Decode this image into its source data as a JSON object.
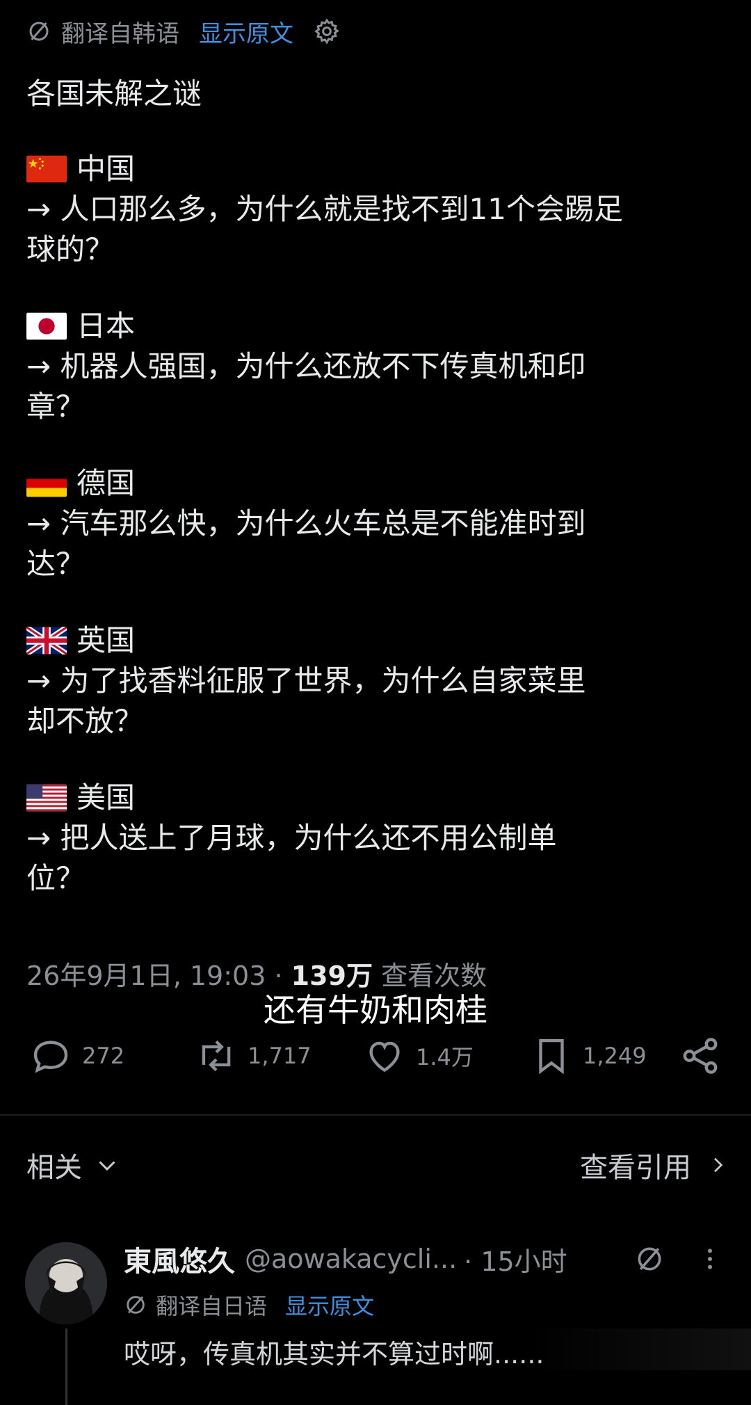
{
  "translate": {
    "label": "翻译自韩语",
    "show_original": "显示原文"
  },
  "post": {
    "title": "各国未解之谜",
    "items": [
      {
        "country": "中国",
        "flag": "china-flag",
        "line1": "→ 人口那么多，为什么就是找不到11个会踢足",
        "line2": "球的？"
      },
      {
        "country": "日本",
        "flag": "japan-flag",
        "line1": "→ 机器人强国，为什么还放不下传真机和印",
        "line2": "章？"
      },
      {
        "country": "德国",
        "flag": "germany-flag",
        "line1": "→ 汽车那么快，为什么火车总是不能准时到",
        "line2": "达？"
      },
      {
        "country": "英国",
        "flag": "uk-flag",
        "line1": "→ 为了找香料征服了世界，为什么自家菜里",
        "line2": "却不放？"
      },
      {
        "country": "美国",
        "flag": "usa-flag",
        "line1": "→ 把人送上了月球，为什么还不用公制单",
        "line2": "位？"
      }
    ]
  },
  "meta": {
    "date": "26年9月1日, 19:03",
    "dot": "·",
    "views": "139万",
    "views_label": "查看次数"
  },
  "subtitle": "还有牛奶和肉桂",
  "actions": {
    "replies": "272",
    "reposts": "1,717",
    "likes": "1.4万",
    "bookmarks": "1,249"
  },
  "related": {
    "label": "相关",
    "quotes": "查看引用"
  },
  "reply": {
    "name": "東風悠久",
    "handle": "@aowakacycli...",
    "time": "· 15小时",
    "translate_label": "翻译自日语",
    "show_original": "显示原文",
    "text": "哎呀，传真机其实并不算过时啊......"
  },
  "colors": {
    "background": "#000000",
    "link": "#3f8fe0",
    "muted": "#8b9096",
    "text": "#e7e9ea"
  }
}
